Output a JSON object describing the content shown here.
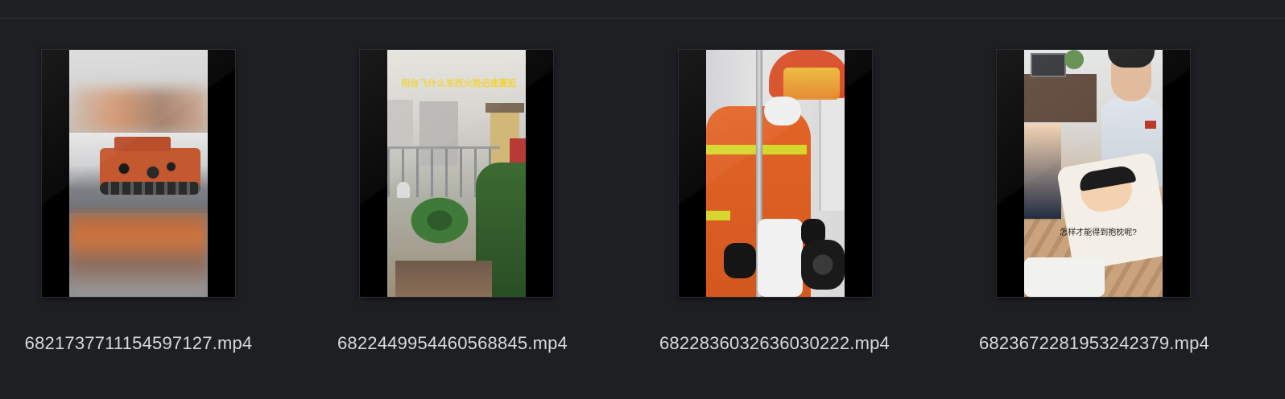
{
  "window": {
    "view": "icon-grid",
    "background": "#1e1f23"
  },
  "files": [
    {
      "name": "6821737711154597127.mp4",
      "icon": "video-thumbnail-icon",
      "thumbnail_subject": "blurred camouflage tank"
    },
    {
      "name": "6822449954460568845.mp4",
      "icon": "video-thumbnail-icon",
      "thumbnail_subject": "balcony with palm plant",
      "caption": "阳台飞什么东西火势迅速蔓延"
    },
    {
      "name": "6822836032636030222.mp4",
      "icon": "video-thumbnail-icon",
      "thumbnail_subject": "firefighter using cutting tool"
    },
    {
      "name": "6823672281953242379.mp4",
      "icon": "video-thumbnail-icon",
      "thumbnail_subject": "officer holding cartoon pillow",
      "caption": "怎样才能得到抱枕呢?"
    }
  ]
}
